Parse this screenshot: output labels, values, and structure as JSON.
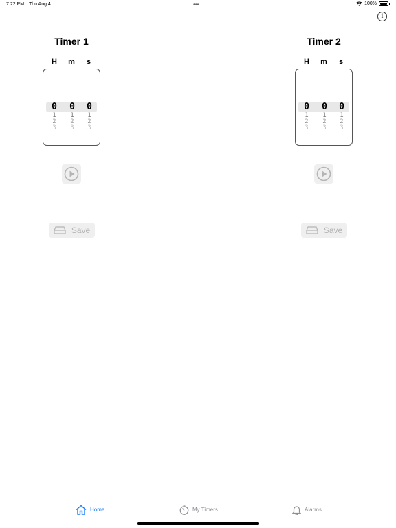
{
  "status_bar": {
    "time": "7:22 PM",
    "date": "Thu Aug 4",
    "dots": "•••",
    "battery": "100%"
  },
  "timers": [
    {
      "title": "Timer 1",
      "units": [
        "H",
        "m",
        "s"
      ],
      "selected": [
        "0",
        "0",
        "0"
      ],
      "below": [
        "1",
        "2",
        "3"
      ],
      "save_label": "Save"
    },
    {
      "title": "Timer 2",
      "units": [
        "H",
        "m",
        "s"
      ],
      "selected": [
        "0",
        "0",
        "0"
      ],
      "below": [
        "1",
        "2",
        "3"
      ],
      "save_label": "Save"
    }
  ],
  "tab_bar": {
    "tabs": [
      {
        "label": "Home",
        "icon": "home-icon",
        "active": true
      },
      {
        "label": "My Timers",
        "icon": "stopwatch-icon",
        "active": false
      },
      {
        "label": "Alarms",
        "icon": "bell-icon",
        "active": false
      }
    ]
  },
  "colors": {
    "accent": "#1a7cf5",
    "inactive": "#8e8e93",
    "disabled": "#b5b5b5",
    "button_bg": "#efefef"
  }
}
